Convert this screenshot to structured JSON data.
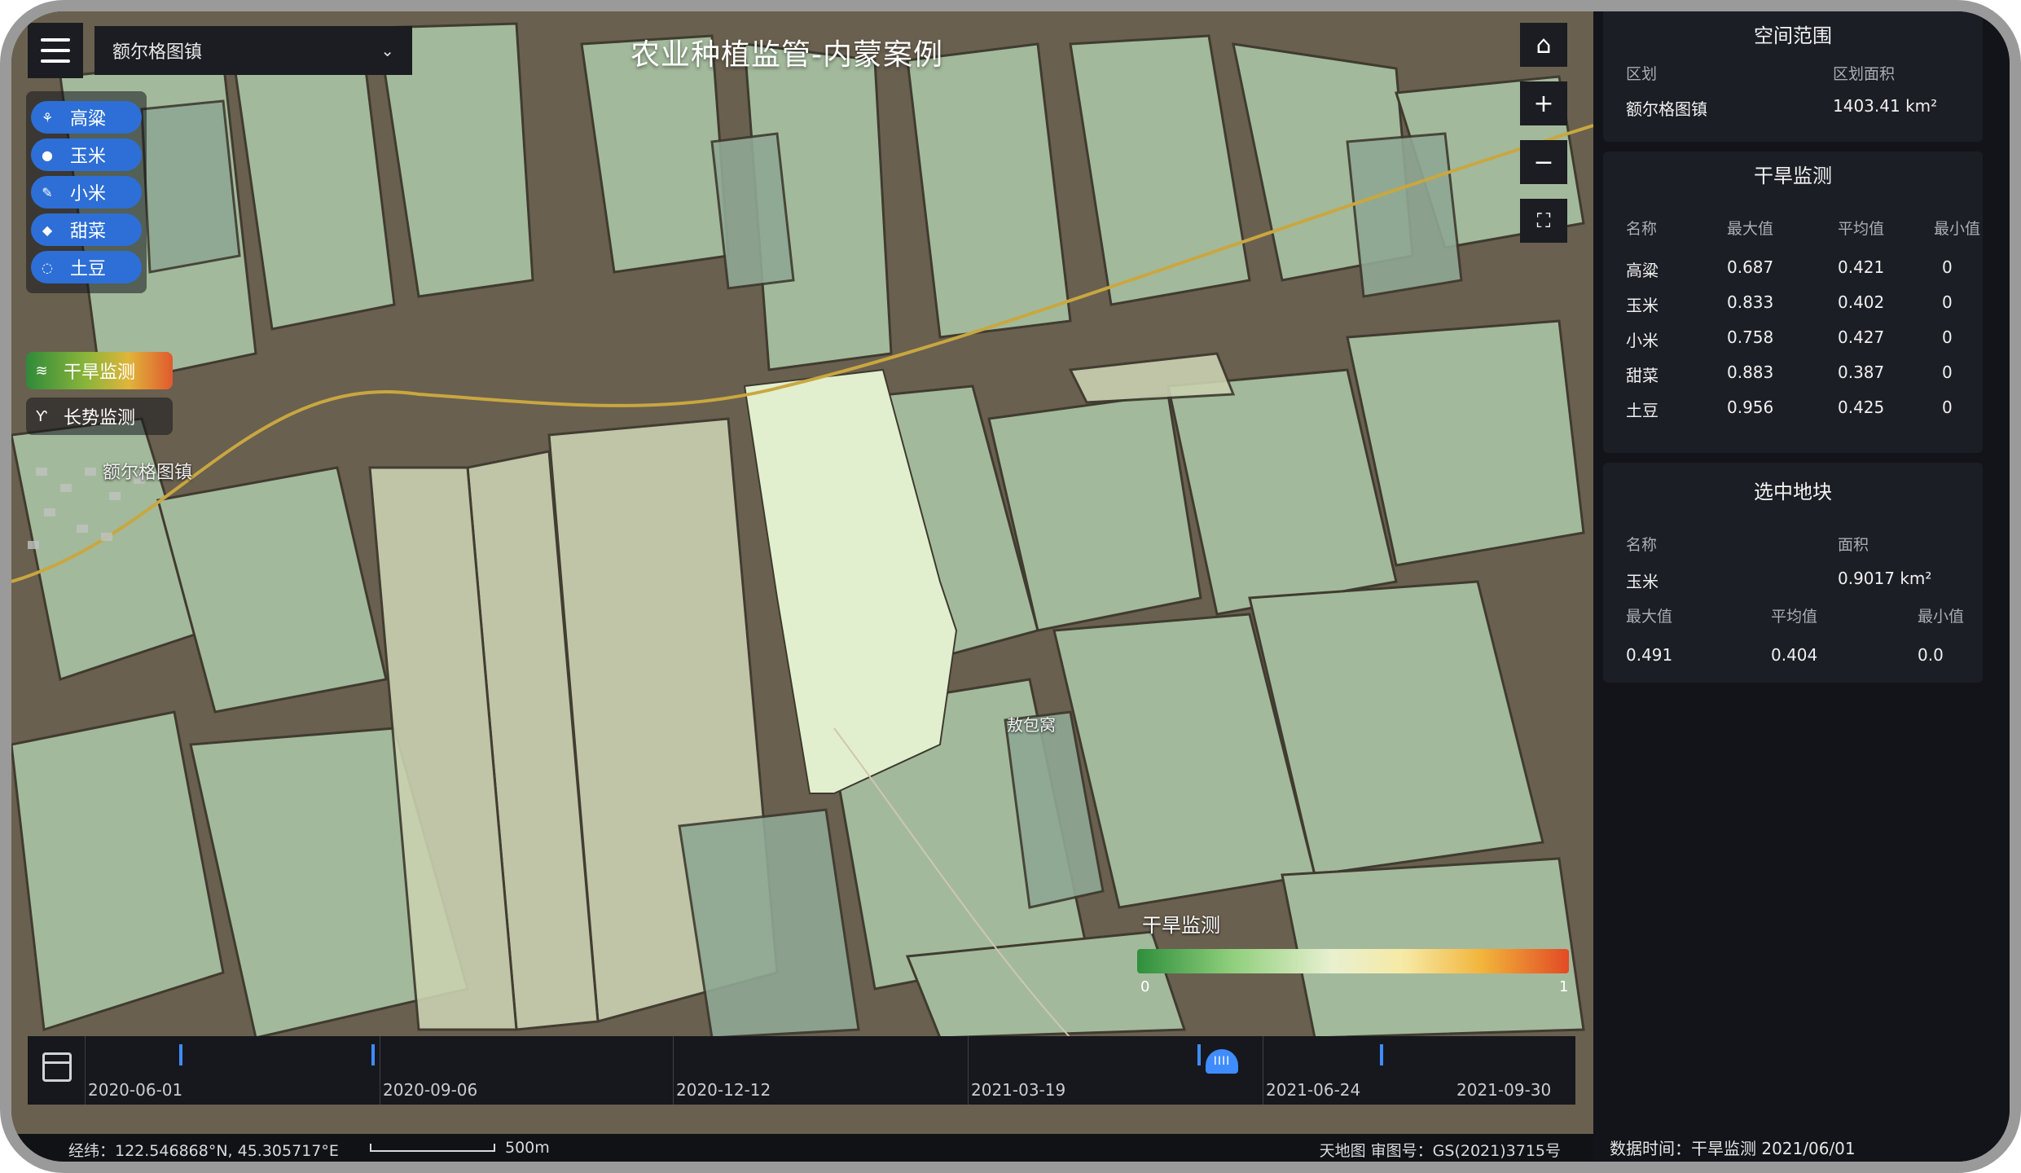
{
  "header": {
    "town_select": "额尔格图镇",
    "title": "农业种植监管-内蒙案例"
  },
  "crops": [
    {
      "label": "高粱",
      "icon": "sorghum-icon"
    },
    {
      "label": "玉米",
      "icon": "corn-icon"
    },
    {
      "label": "小米",
      "icon": "millet-icon"
    },
    {
      "label": "甜菜",
      "icon": "beet-icon"
    },
    {
      "label": "土豆",
      "icon": "potato-icon"
    }
  ],
  "layers": [
    {
      "label": "干旱监测",
      "icon": "drought-icon",
      "active": true
    },
    {
      "label": "长势监测",
      "icon": "growth-icon",
      "active": false
    }
  ],
  "map_labels": {
    "town": "额尔格图镇",
    "village": "敖包窝"
  },
  "legend": {
    "title": "干旱监测",
    "min": "0",
    "max": "1"
  },
  "timeline": {
    "labels": [
      "2020-06-01",
      "2020-09-06",
      "2020-12-12",
      "2021-03-19",
      "2021-06-24",
      "2021-09-30"
    ],
    "handle_icon": "IIII"
  },
  "statusbar": {
    "coords": "经纬：122.546868°N, 45.305717°E",
    "scale": "500m",
    "attribution": "天地图 审图号：GS(2021)3715号"
  },
  "panel": {
    "spatial": {
      "title": "空间范围",
      "col1": "区划",
      "col2": "区划面积",
      "name": "额尔格图镇",
      "area": "1403.41 km²"
    },
    "drought": {
      "title": "干旱监测",
      "headers": [
        "名称",
        "最大值",
        "平均值",
        "最小值"
      ],
      "rows": [
        [
          "高粱",
          "0.687",
          "0.421",
          "0"
        ],
        [
          "玉米",
          "0.833",
          "0.402",
          "0"
        ],
        [
          "小米",
          "0.758",
          "0.427",
          "0"
        ],
        [
          "甜菜",
          "0.883",
          "0.387",
          "0"
        ],
        [
          "土豆",
          "0.956",
          "0.425",
          "0"
        ]
      ]
    },
    "selected": {
      "title": "选中地块",
      "h_name": "名称",
      "h_area": "面积",
      "name": "玉米",
      "area": "0.9017 km²",
      "h_max": "最大值",
      "h_avg": "平均值",
      "h_min": "最小值",
      "max": "0.491",
      "avg": "0.404",
      "min": "0.0"
    },
    "data_time": "数据时间：干旱监测 2021/06/01"
  },
  "colors": {
    "accent": "#3f8cff",
    "crop_button": "#2d6fd6",
    "panel_bg": "#121419"
  }
}
